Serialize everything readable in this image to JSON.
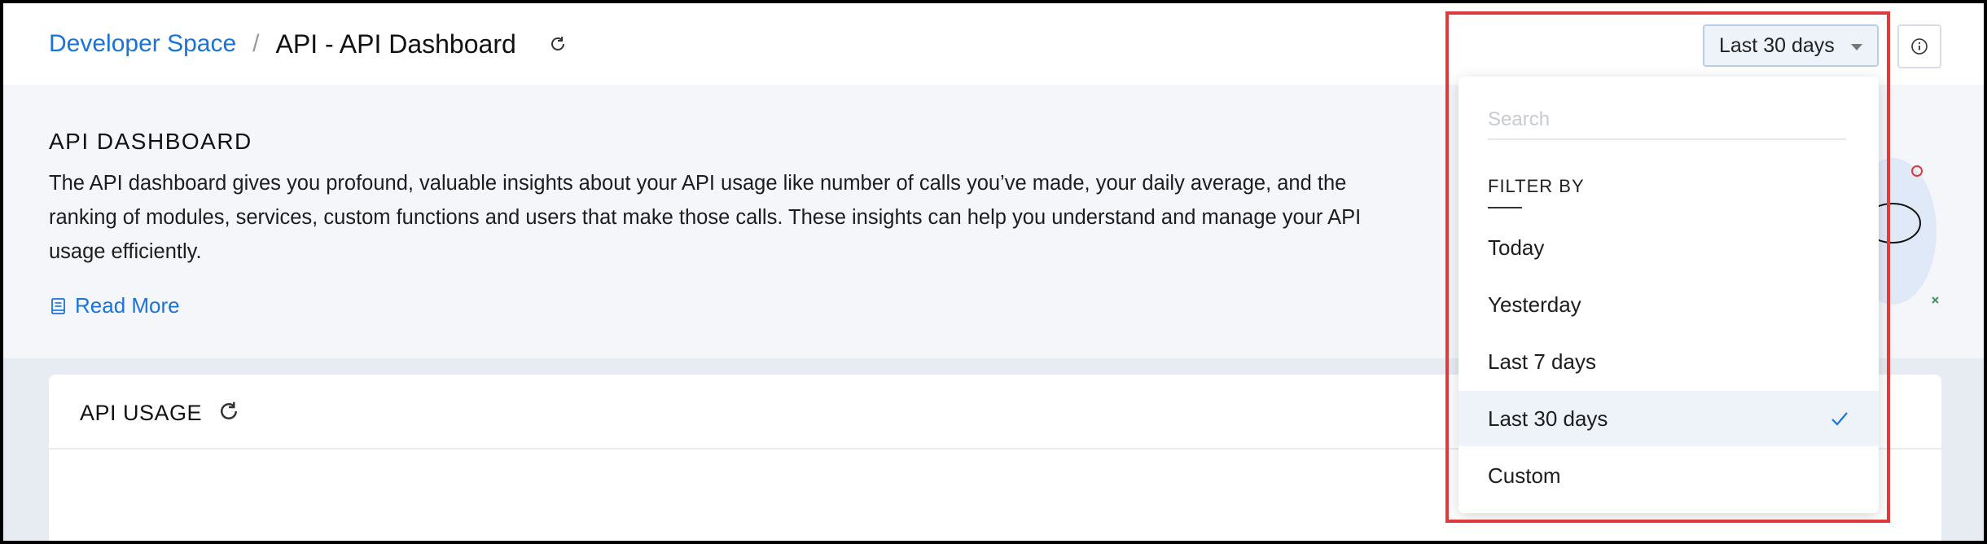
{
  "header": {
    "breadcrumb_root": "Developer Space",
    "breadcrumb_sep": "/",
    "page_title": "API - API Dashboard",
    "range_value": "Last 30 days"
  },
  "intro": {
    "title": "API DASHBOARD",
    "description": "The API dashboard gives you profound, valuable insights about your API usage like number of calls you’ve made, your daily average, and the ranking of modules, services, custom functions and users that make those calls. These insights can help you understand and manage your API usage efficiently.",
    "read_more": "Read More"
  },
  "usage": {
    "title": "API USAGE"
  },
  "dropdown": {
    "search_placeholder": "Search",
    "filter_label": "FILTER BY",
    "options": [
      "Today",
      "Yesterday",
      "Last 7 days",
      "Last 30 days",
      "Custom"
    ],
    "selected": "Last 30 days"
  },
  "colors": {
    "link": "#1a73d9",
    "highlight": "#e03a3a",
    "selected_bg": "#eef3fa"
  },
  "icons": [
    "refresh-icon",
    "chevron-down-icon",
    "info-icon",
    "book-icon",
    "check-icon"
  ]
}
